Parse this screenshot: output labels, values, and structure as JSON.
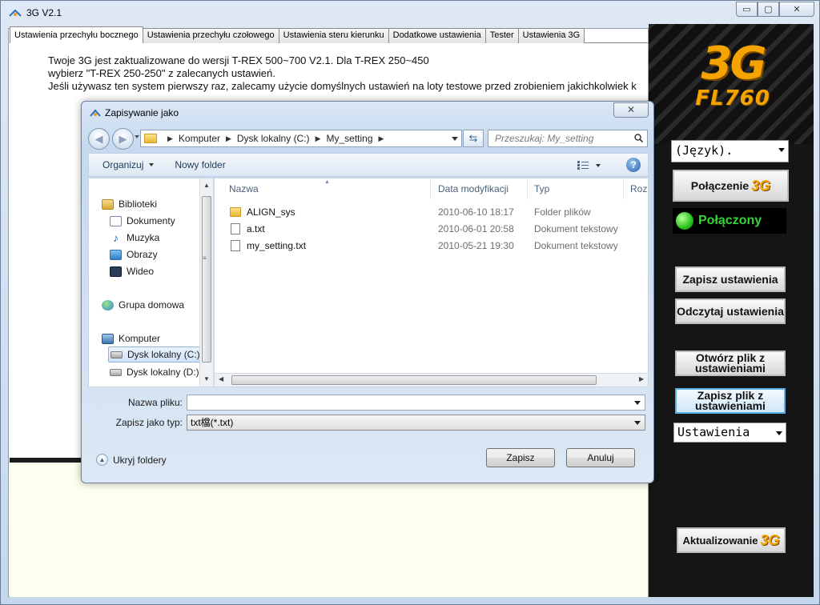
{
  "window": {
    "title": "3G V2.1",
    "min_glyph": "▭",
    "max_glyph": "▢",
    "close_glyph": "✕"
  },
  "tabs": [
    "Ustawienia przechyłu bocznego",
    "Ustawienia przechyłu czołowego",
    "Ustawienia steru kierunku",
    "Dodatkowe ustawienia",
    "Tester",
    "Ustawienia 3G"
  ],
  "info": {
    "line1": "Twoje 3G jest zaktualizowane do wersji T-REX 500~700 V2.1. Dla T-REX 250~450",
    "line2": "wybierz \"T-REX 250-250\" z zalecanych ustawień.",
    "line3": "Jeśli używasz ten system pierwszy raz, zalecamy użycie domyślnych ustawień na loty testowe przed zrobieniem jakichkolwiek k"
  },
  "sidebar": {
    "logo_main": "3G",
    "logo_model": "FL760",
    "language_select": "(Język).",
    "connect_button": "Połączenie",
    "connect_badge": "3G",
    "status_text": "Połączony",
    "save_button": "Zapisz ustawienia",
    "read_button": "Odczytaj ustawienia",
    "open_file_button_l1": "Otwórz plik z",
    "open_file_button_l2": "ustawieniami",
    "save_file_button_l1": "Zapisz plik z",
    "save_file_button_l2": "ustawieniami",
    "settings_select": "Ustawienia",
    "update_button": "Aktualizowanie",
    "update_badge": "3G"
  },
  "dialog": {
    "title": "Zapisywanie jako",
    "close_glyph": "✕",
    "breadcrumb": [
      "Komputer",
      "Dysk lokalny (C:)",
      "My_setting"
    ],
    "search_placeholder": "Przeszukaj: My_setting",
    "toolbar": {
      "organize": "Organizuj",
      "new_folder": "Nowy folder",
      "help": "?"
    },
    "nav_tree": [
      {
        "label": "Biblioteki",
        "icon": "library-icon"
      },
      {
        "label": "Dokumenty",
        "icon": "documents-icon"
      },
      {
        "label": "Muzyka",
        "icon": "music-icon"
      },
      {
        "label": "Obrazy",
        "icon": "pictures-icon"
      },
      {
        "label": "Wideo",
        "icon": "video-icon"
      },
      {
        "label": "Grupa domowa",
        "icon": "homegroup-icon"
      },
      {
        "label": "Komputer",
        "icon": "computer-icon"
      },
      {
        "label": "Dysk lokalny (C:)",
        "icon": "disk-icon"
      },
      {
        "label": "Dysk lokalny (D:)",
        "icon": "disk-icon"
      }
    ],
    "columns": {
      "name": "Nazwa",
      "modified": "Data modyfikacji",
      "type": "Typ",
      "size": "Rozm"
    },
    "files": [
      {
        "name": "ALIGN_sys",
        "modified": "2010-06-10 18:17",
        "type": "Folder plików",
        "icon": "folder-icon"
      },
      {
        "name": "a.txt",
        "modified": "2010-06-01 20:58",
        "type": "Dokument tekstowy",
        "icon": "text-file-icon"
      },
      {
        "name": "my_setting.txt",
        "modified": "2010-05-21 19:30",
        "type": "Dokument tekstowy",
        "icon": "text-file-icon"
      }
    ],
    "filename_label": "Nazwa pliku:",
    "filename_value": "",
    "filetype_label": "Zapisz jako typ:",
    "filetype_value": "txt檔(*.txt)",
    "hide_folders": "Ukryj foldery",
    "save_button": "Zapisz",
    "cancel_button": "Anuluj"
  },
  "colors": {
    "accent_logo": "#f5a300",
    "status_green": "#35d435",
    "sidebar_bg": "#151515"
  }
}
